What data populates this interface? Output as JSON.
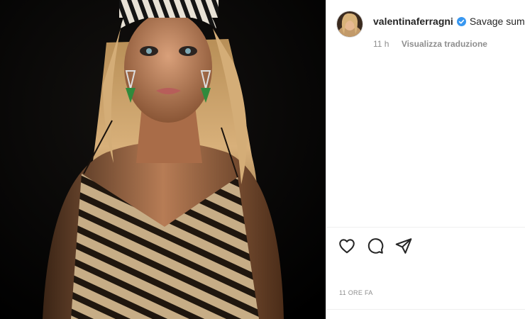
{
  "post": {
    "author": {
      "username": "valentinaferragni",
      "verified": true
    },
    "caption_preview": "Savage summ",
    "time_ago": "11 h",
    "translate_label": "Visualizza traduzione",
    "timestamp": "11 ORE FA",
    "actions": [
      "like-icon",
      "comment-icon",
      "share-icon"
    ],
    "verified_color": "#3897f0"
  }
}
